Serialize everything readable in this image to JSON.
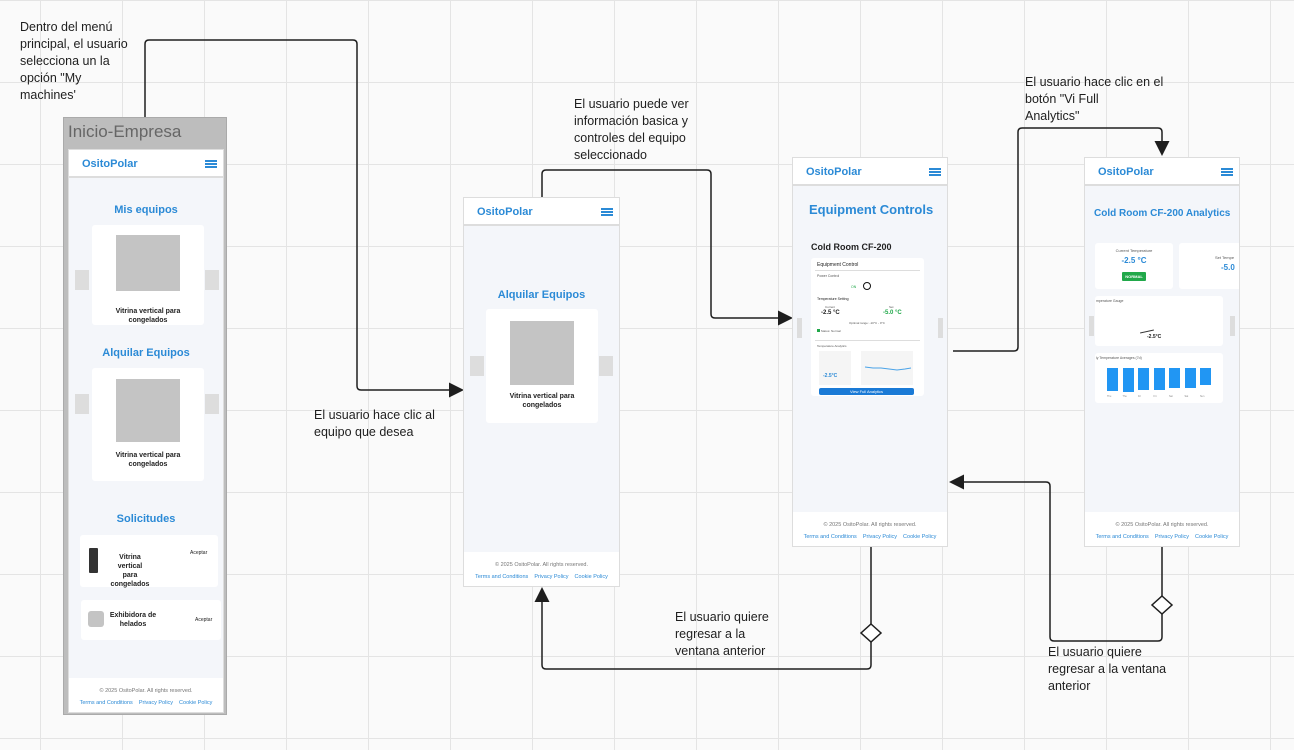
{
  "notes": {
    "start": "Dentro del menú\nprincipal, el usuario\nselecciona un la\nopción \"My\nmachines'",
    "select_equipment": "El usuario hace clic al\nequipo que desea",
    "view_info": "El usuario puede ver\ninformación basica y\ncontroles del equipo\nseleccionado",
    "full_analytics": "El usuario hace clic en el\nbotón \"Vi Full\nAnalytics\"",
    "back_1": "El usuario quiere\nregresar a la\nventana anterior",
    "back_2": "El usuario quiere\nregresar a la ventana\nanterior"
  },
  "brand": "OsitoPolar",
  "footer": {
    "copyright": "© 2025 OsitoPolar. All rights reserved.",
    "terms": "Terms and Conditions",
    "privacy": "Privacy Policy",
    "cookie": "Cookie Policy"
  },
  "screen1": {
    "frame_title": "Inicio-Empresa",
    "mis_equipos": "Mis equipos",
    "alquilar": "Alquilar Equipos",
    "solicitudes": "Solicitudes",
    "item1": "Vitrina vertical para congelados",
    "item2": "Vitrina vertical para congelados",
    "req1": "Vitrina vertical para congelados",
    "req2": "Exhibidora de helados",
    "accept": "Aceptar"
  },
  "screen2": {
    "title": "Alquilar Equipos",
    "item": "Vitrina vertical para congelados"
  },
  "screen3": {
    "title": "Equipment Controls",
    "device": "Cold Room CF-200",
    "panel": "Equipment Control",
    "power": "Power Control",
    "on": "ON",
    "temp_setting": "Temperature Setting",
    "current_label": "Current",
    "current": "-2.5 °C",
    "set_label": "Set",
    "set": "-5.0 °C",
    "optimal": "Optimal range: -10°C - 0°C",
    "status": "Status: Normal",
    "analytics": "Temperature Analytics",
    "gauge_value": "-2.5°C",
    "button": "View Full Analytics"
  },
  "screen4": {
    "title": "Cold Room CF-200 Analytics",
    "current_label": "Current Temperature",
    "current": "-2.5 °C",
    "status": "NORMAL",
    "set_label": "Set Tempe",
    "set": "-5.0",
    "gauge_title": "mperature Gauge",
    "gauge_value": "-2.5°C",
    "bars_title": "ly Temperature Averages (7d)",
    "days": [
      "Thu",
      "Thu",
      "Fri",
      "Fri",
      "Sat",
      "Sat",
      "Sun"
    ]
  },
  "colors": {
    "accent": "#2b8ad6",
    "ok": "#21a84a",
    "line": "#1e1e1e"
  }
}
